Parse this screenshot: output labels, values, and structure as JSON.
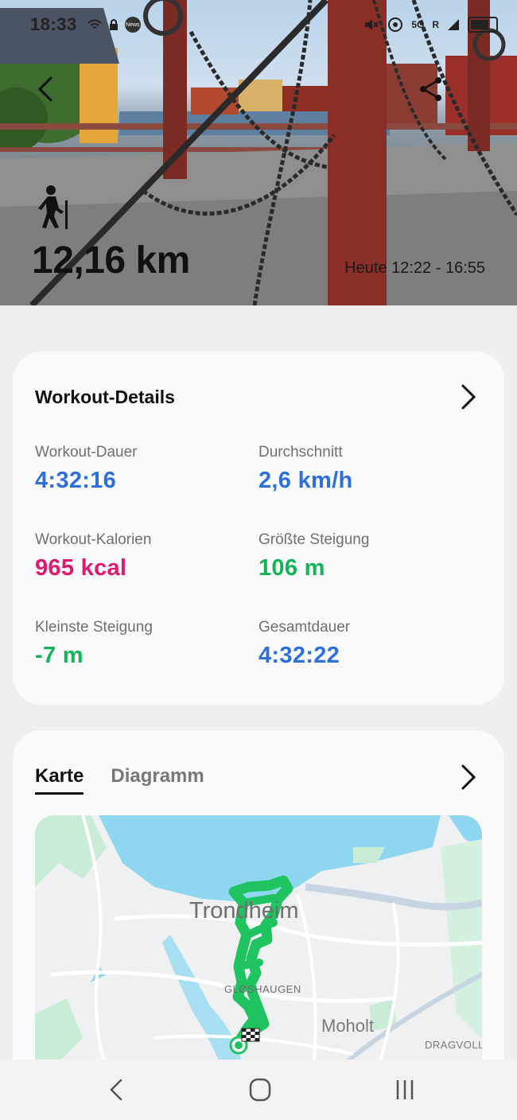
{
  "status_bar": {
    "time": "18:33",
    "news_badge": "News",
    "network": "5G",
    "signal_letter": "R",
    "icons": [
      "wifi-icon",
      "lock-icon",
      "news-icon",
      "mute-icon",
      "hotspot-icon",
      "signal-icon",
      "battery-icon"
    ]
  },
  "hero": {
    "distance": "12,16 km",
    "time_range": "Heute 12:22 - 16:55",
    "activity_icon": "hiking-icon"
  },
  "workout_details": {
    "title": "Workout-Details",
    "metrics": [
      {
        "label": "Workout-Dauer",
        "value": "4:32:16",
        "color": "#2d6fdc"
      },
      {
        "label": "Durchschnitt",
        "value": "2,6 km/h",
        "color": "#2d6fdc"
      },
      {
        "label": "Workout-Kalorien",
        "value": "965 kcal",
        "color": "#e0186f"
      },
      {
        "label": "Größte Steigung",
        "value": "106 m",
        "color": "#12b458"
      },
      {
        "label": "Kleinste Steigung",
        "value": "-7 m",
        "color": "#12b458"
      },
      {
        "label": "Gesamtdauer",
        "value": "4:32:22",
        "color": "#2d6fdc"
      }
    ]
  },
  "map_card": {
    "tabs": [
      {
        "label": "Karte",
        "active": true
      },
      {
        "label": "Diagramm",
        "active": false
      }
    ],
    "map_labels": {
      "city": "Trondheim",
      "district": "GLØSHAUGEN",
      "area": "Moholt",
      "edge": "DRAGVOLL-"
    },
    "route_color": "#1fc35f",
    "water_color": "#8fd6f0"
  },
  "nav_bar": {
    "buttons": [
      "back-nav-icon",
      "home-nav-icon",
      "recents-nav-icon"
    ]
  }
}
